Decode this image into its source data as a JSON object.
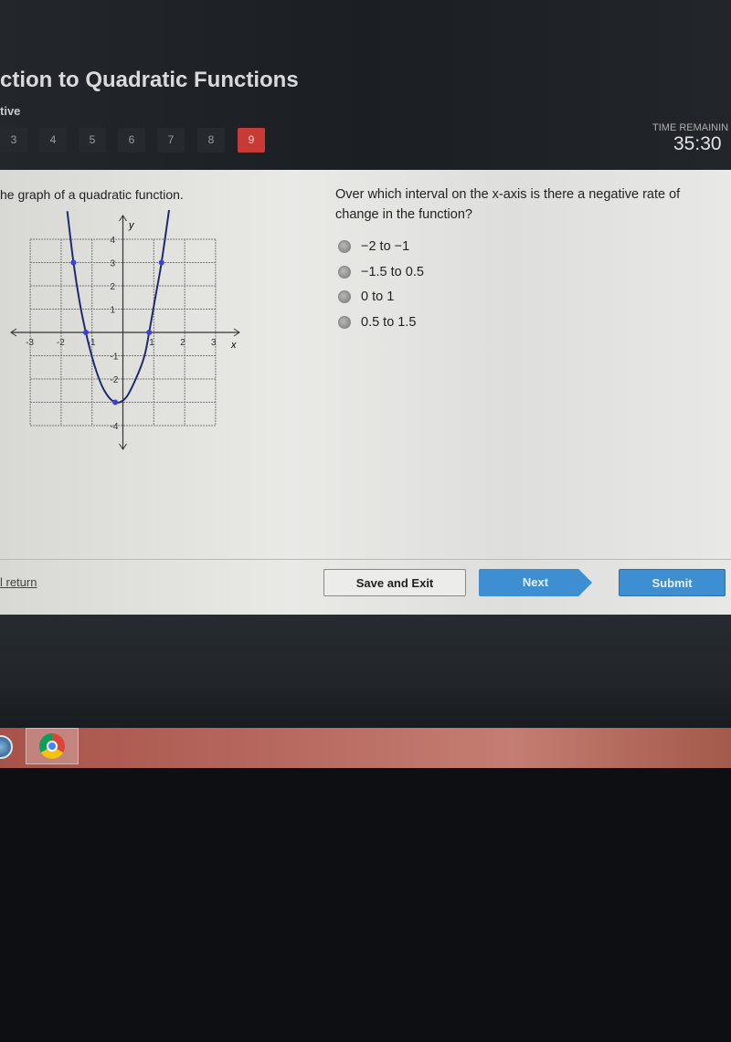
{
  "header": {
    "title": "ction to Quadratic Functions",
    "subtitle": "tive",
    "question_numbers": [
      "3",
      "4",
      "5",
      "6",
      "7",
      "8",
      "9"
    ],
    "active_question": "9",
    "time_label": "TIME REMAININ",
    "time_value": "35:30"
  },
  "question": {
    "intro": "he graph of a quadratic function.",
    "prompt": "Over which interval on the x-axis is there a negative rate of change in the function?",
    "options": [
      "−2 to −1",
      "−1.5 to 0.5",
      "0 to 1",
      "0.5 to 1.5"
    ]
  },
  "footer": {
    "return_link": "l return",
    "save_exit": "Save and Exit",
    "next": "Next",
    "submit": "Submit"
  },
  "taskbar": {
    "icons": [
      "windows-start-icon",
      "chrome-icon"
    ]
  },
  "colors": {
    "active_question": "#c83a36",
    "primary_button": "#3e8fd2",
    "curve": "#1e2a6e",
    "points": "#3a3fe0"
  },
  "chart_data": {
    "type": "line",
    "xlabel": "x",
    "ylabel": "y",
    "xlim": [
      -3,
      3
    ],
    "ylim": [
      -4,
      4
    ],
    "grid": true,
    "x_ticks": [
      "-3",
      "-2",
      "-1",
      "1",
      "2",
      "3"
    ],
    "y_ticks": [
      "4",
      "3",
      "2",
      "1",
      "-1",
      "-2",
      "-4"
    ],
    "marked_points": [
      [
        -1.6,
        3
      ],
      [
        -1.2,
        0
      ],
      [
        -0.25,
        -3
      ],
      [
        0.85,
        0
      ],
      [
        1.25,
        3
      ]
    ],
    "curve": [
      [
        -1.8,
        5.2
      ],
      [
        -1.6,
        3
      ],
      [
        -1.4,
        1.3
      ],
      [
        -1.2,
        0
      ],
      [
        -0.9,
        -1.5
      ],
      [
        -0.6,
        -2.5
      ],
      [
        -0.25,
        -3
      ],
      [
        0.1,
        -2.8
      ],
      [
        0.45,
        -1.9
      ],
      [
        0.7,
        -1
      ],
      [
        0.85,
        0
      ],
      [
        1.05,
        1.5
      ],
      [
        1.25,
        3
      ],
      [
        1.5,
        5.3
      ]
    ]
  }
}
